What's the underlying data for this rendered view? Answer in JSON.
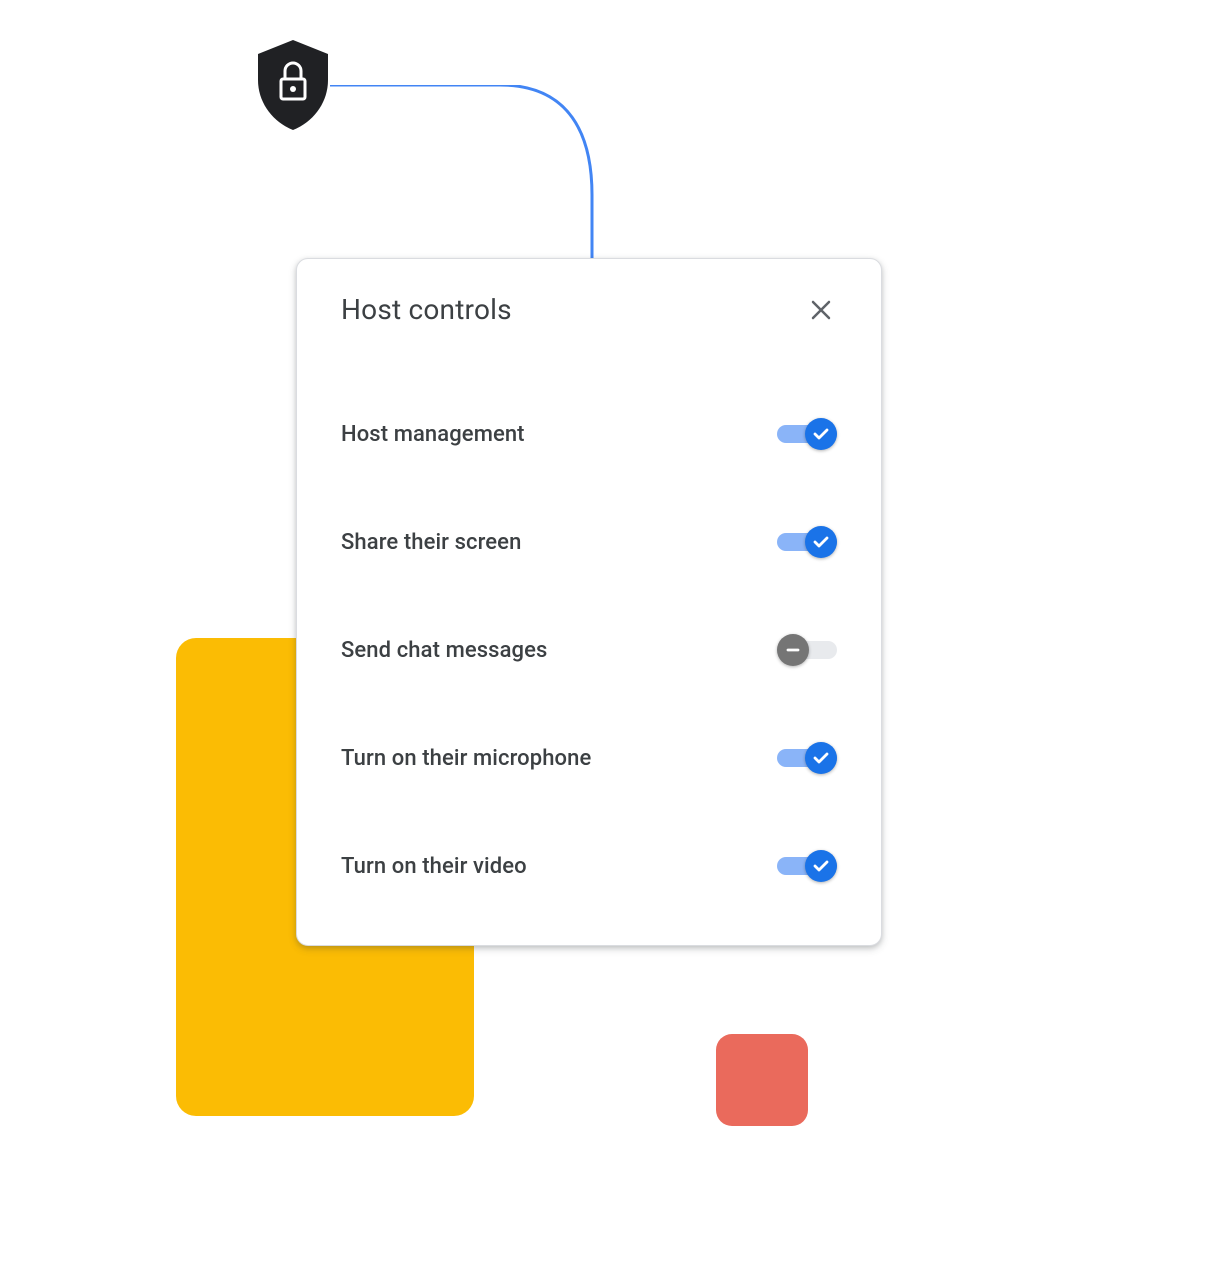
{
  "dialog": {
    "title": "Host controls",
    "options": [
      {
        "label": "Host management",
        "enabled": true
      },
      {
        "label": "Share their screen",
        "enabled": true
      },
      {
        "label": "Send chat messages",
        "enabled": false
      },
      {
        "label": "Turn on their microphone",
        "enabled": true
      },
      {
        "label": "Turn on their video",
        "enabled": true
      }
    ]
  },
  "decoration": {
    "shield_icon": "shield-lock-icon",
    "accent_blocks": [
      "yellow",
      "red"
    ]
  },
  "colors": {
    "toggle_on_track": "#8ab4f8",
    "toggle_on_thumb": "#1a73e8",
    "toggle_off_track": "#e8eaed",
    "toggle_off_thumb": "#757575",
    "yellow": "#fbbc04",
    "red": "#ea6a5c",
    "connector": "#4285f4"
  }
}
